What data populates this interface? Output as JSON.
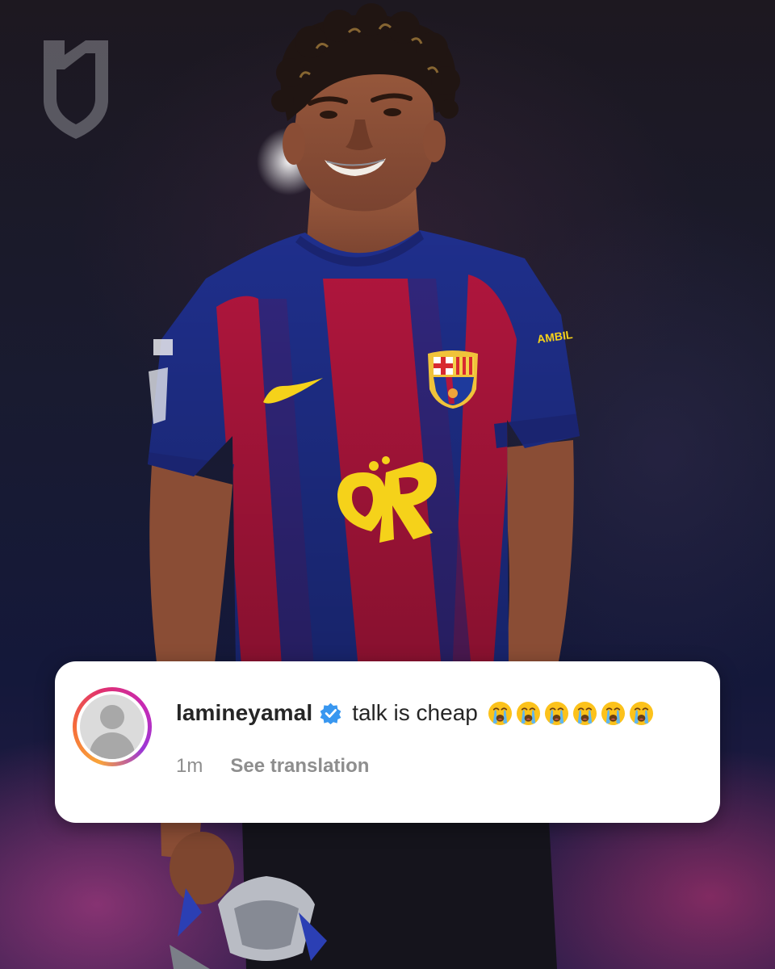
{
  "post": {
    "brand_logo_icon": "shield-monogram-icon",
    "photo_description_icon": "player-photo"
  },
  "comment": {
    "username": "lamineyamal",
    "verified_icon": "verified-badge-icon",
    "text": "talk is cheap",
    "emojis": [
      "😭",
      "😭",
      "😭",
      "😭",
      "😭",
      "😭"
    ],
    "emoji_icon": "loudly-crying-face-icon",
    "timestamp": "1m",
    "translation_label": "See translation",
    "avatar_icon": "default-avatar-icon"
  },
  "colors": {
    "verified_blue": "#3897f0",
    "text_primary": "#262626",
    "text_secondary": "#8e8e8e",
    "kit_blue": "#1f2f8c",
    "kit_red": "#b3163e",
    "sponsor_yellow": "#f5d21a"
  }
}
